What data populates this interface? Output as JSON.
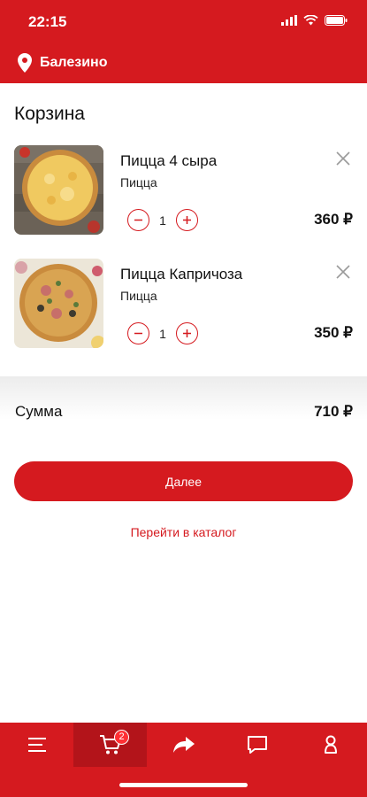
{
  "status": {
    "time": "22:15"
  },
  "location": {
    "city": "Балезино",
    "icon": "location-pin-icon"
  },
  "cart": {
    "title": "Корзина",
    "items": [
      {
        "title": "Пицца 4 сыра",
        "category": "Пицца",
        "quantity": "1",
        "price": "360 ₽"
      },
      {
        "title": "Пицца Капричоза",
        "category": "Пицца",
        "quantity": "1",
        "price": "350 ₽"
      }
    ]
  },
  "summary": {
    "label": "Сумма",
    "value": "710 ₽"
  },
  "actions": {
    "next_label": "Далее",
    "catalog_label": "Перейти в каталог"
  },
  "tabbar": {
    "cart_badge": "2"
  },
  "colors": {
    "brand": "#d51a1f",
    "brand_dark": "#b3141a"
  }
}
